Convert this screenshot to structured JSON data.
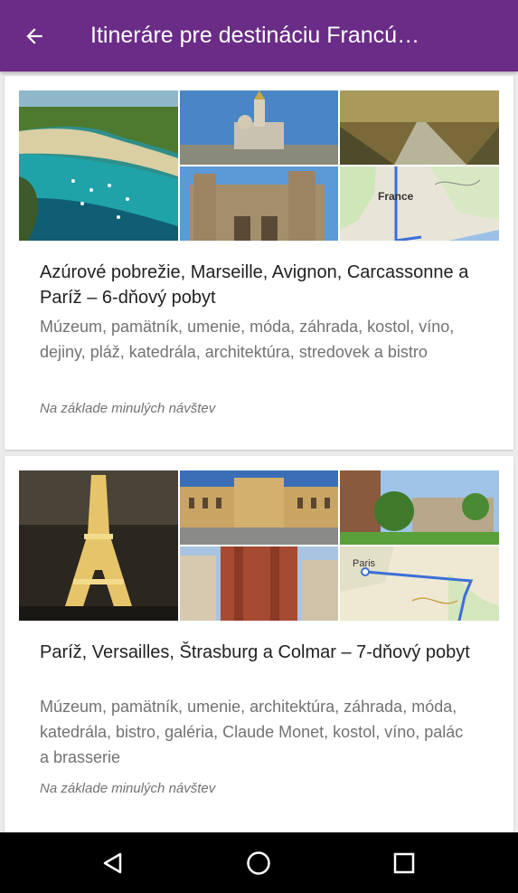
{
  "app_bar": {
    "title": "Itineráre pre destináciu Francú…",
    "back_icon": "arrow-back-icon",
    "color": "#6a2c87"
  },
  "cards": [
    {
      "title": "Azúrové pobrežie, Marseille, Avignon, Carcassonne a Paríž – 6-dňový pobyt",
      "tags": "Múzeum, pamätník, umenie, móda, záhrada, kostol, víno, dejiny, pláž, katedrála, architektúra, stredovek a bistro",
      "note": "Na základe minulých návštev",
      "map_label": "France"
    },
    {
      "title": "Paríž, Versailles, Štrasburg a Colmar – 7-dňový pobyt",
      "tags": "Múzeum, pamätník, umenie, architektúra, záhrada, móda, katedrála, bistro, galéria, Claude Monet, kostol, víno, palác a brasserie",
      "note": "Na základe minulých návštev",
      "map_label": "Paris"
    }
  ],
  "nav_bar": {
    "back_icon": "nav-back-icon",
    "home_icon": "nav-home-icon",
    "recents_icon": "nav-recents-icon"
  }
}
